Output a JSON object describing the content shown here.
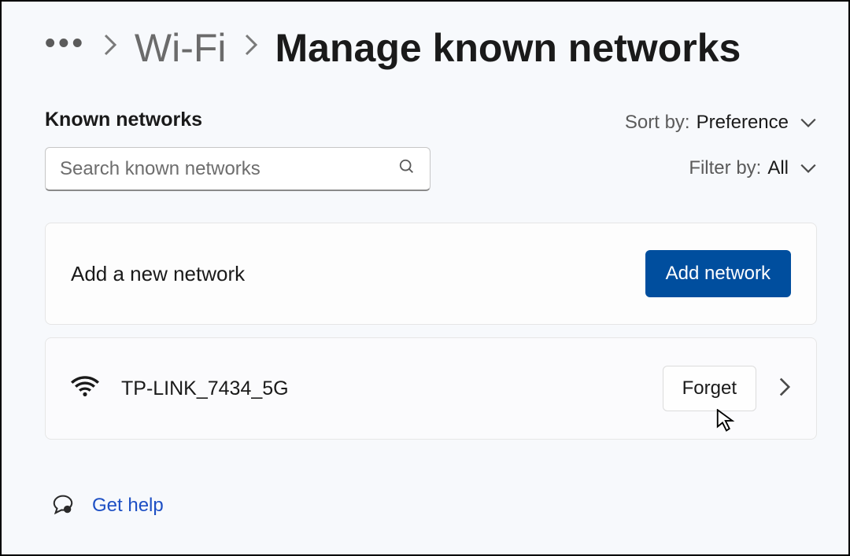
{
  "breadcrumb": {
    "ellipsis": "•••",
    "parent": "Wi-Fi",
    "current": "Manage known networks"
  },
  "section_title": "Known networks",
  "search": {
    "placeholder": "Search known networks"
  },
  "sort": {
    "label": "Sort by:",
    "value": "Preference"
  },
  "filter": {
    "label": "Filter by:",
    "value": "All"
  },
  "add_card": {
    "label": "Add a new network",
    "button": "Add network"
  },
  "networks": [
    {
      "name": "TP-LINK_7434_5G",
      "forget": "Forget"
    }
  ],
  "help": {
    "label": "Get help"
  }
}
